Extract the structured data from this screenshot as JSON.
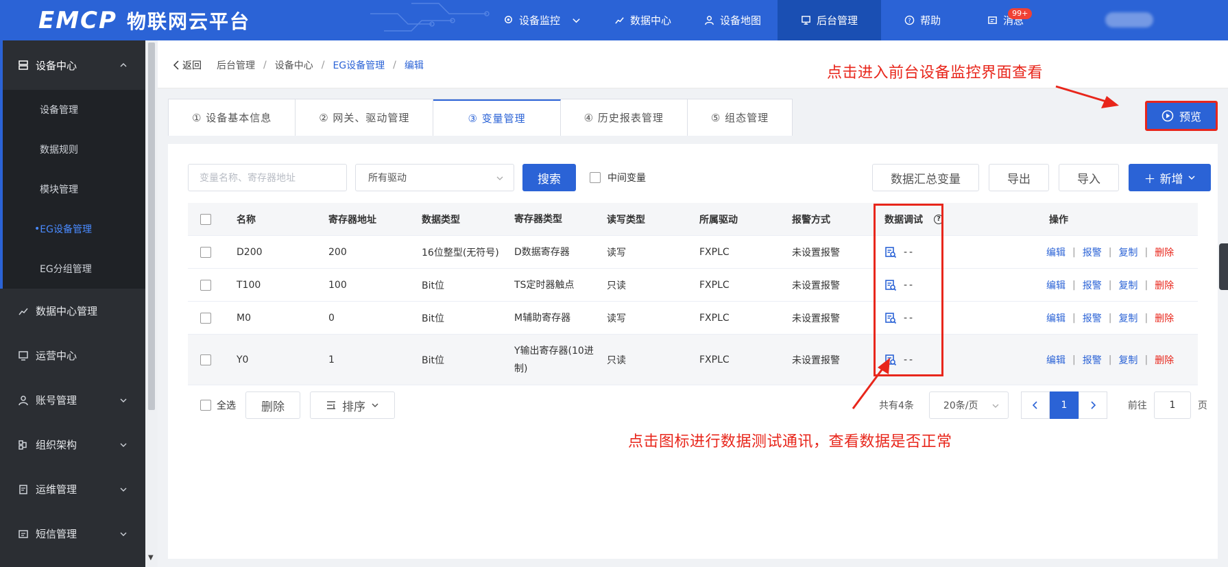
{
  "brand": {
    "logo": "EMCP",
    "title": "物联网云平台"
  },
  "nav": [
    {
      "label": "设备监控",
      "icon": "location-pin-icon",
      "dropdown": true
    },
    {
      "label": "数据中心",
      "icon": "chart-icon"
    },
    {
      "label": "设备地图",
      "icon": "user-icon"
    },
    {
      "label": "后台管理",
      "icon": "monitor-icon",
      "active": true
    },
    {
      "label": "帮助",
      "icon": "help-icon"
    },
    {
      "label": "消息",
      "icon": "message-icon",
      "badge": "99+"
    }
  ],
  "sidebar": {
    "group": {
      "label": "设备中心",
      "icon": "server-icon"
    },
    "subs": [
      "设备管理",
      "数据规则",
      "模块管理",
      "EG设备管理",
      "EG分组管理"
    ],
    "items": [
      {
        "label": "数据中心管理",
        "icon": "chart-icon"
      },
      {
        "label": "运营中心",
        "icon": "monitor-icon"
      },
      {
        "label": "账号管理",
        "icon": "user-icon"
      },
      {
        "label": "组织架构",
        "icon": "org-icon"
      },
      {
        "label": "运维管理",
        "icon": "tools-icon"
      },
      {
        "label": "短信管理",
        "icon": "sms-icon"
      }
    ]
  },
  "breadcrumb": {
    "back": "返回",
    "items": [
      "后台管理",
      "设备中心",
      "EG设备管理",
      "编辑"
    ]
  },
  "annotations": {
    "top": "点击进入前台设备监控界面查看",
    "bottom": "点击图标进行数据测试通讯，查看数据是否正常"
  },
  "tabs": [
    "① 设备基本信息",
    "② 网关、驱动管理",
    "③ 变量管理",
    "④ 历史报表管理",
    "⑤ 组态管理"
  ],
  "preview_label": "预览",
  "toolbar": {
    "search_placeholder": "变量名称、寄存器地址",
    "driver_select": "所有驱动",
    "search_button": "搜索",
    "intermediate_label": "中间变量",
    "summary_button": "数据汇总变量",
    "export_button": "导出",
    "import_button": "导入",
    "new_button": "新增"
  },
  "table": {
    "headers": [
      "名称",
      "寄存器地址",
      "数据类型",
      "寄存器类型",
      "读写类型",
      "所属驱动",
      "报警方式",
      "数据调试",
      "操作"
    ],
    "rows": [
      {
        "name": "D200",
        "addr": "200",
        "dtype": "16位整型(无符号)",
        "rtype": "D数据寄存器",
        "rw": "读写",
        "driver": "FXPLC",
        "alarm": "未设置报警",
        "debug": "--"
      },
      {
        "name": "T100",
        "addr": "100",
        "dtype": "Bit位",
        "rtype": "TS定时器触点",
        "rw": "只读",
        "driver": "FXPLC",
        "alarm": "未设置报警",
        "debug": "--"
      },
      {
        "name": "M0",
        "addr": "0",
        "dtype": "Bit位",
        "rtype": "M辅助寄存器",
        "rw": "读写",
        "driver": "FXPLC",
        "alarm": "未设置报警",
        "debug": "--"
      },
      {
        "name": "Y0",
        "addr": "1",
        "dtype": "Bit位",
        "rtype": "Y输出寄存器(10进制)",
        "rw": "只读",
        "driver": "FXPLC",
        "alarm": "未设置报警",
        "debug": "--"
      }
    ],
    "ops": {
      "edit": "编辑",
      "alarm": "报警",
      "copy": "复制",
      "delete": "删除"
    }
  },
  "footer": {
    "select_all": "全选",
    "delete": "删除",
    "sort": "排序",
    "total": "共有4条",
    "page_size": "20条/页",
    "current_page": "1",
    "goto_label": "前往",
    "goto_value": "1",
    "page_unit": "页"
  },
  "colors": {
    "primary": "#2b63d6",
    "sidebar": "#2b2e33",
    "annotation": "#e8261b"
  }
}
